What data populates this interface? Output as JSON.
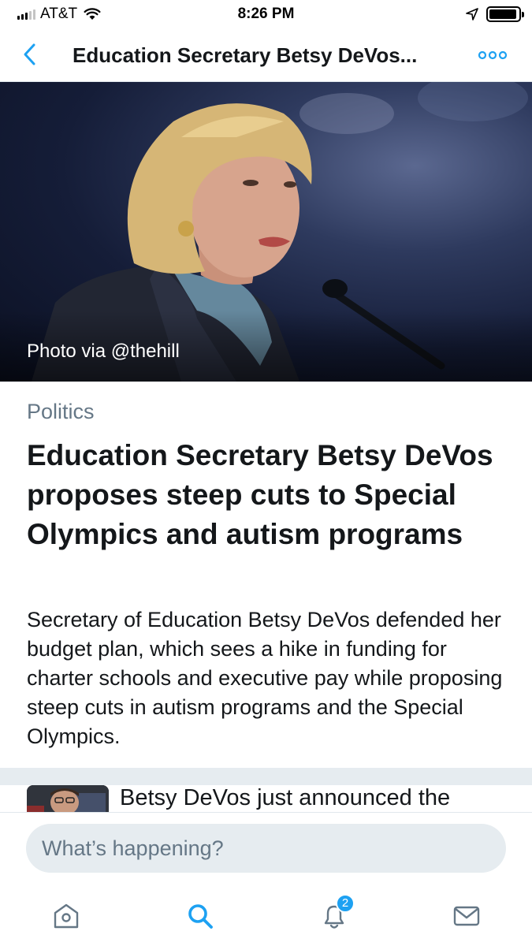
{
  "status_bar": {
    "carrier": "AT&T",
    "time": "8:26 PM",
    "signal_bars_on": 3,
    "signal_bars_total": 5,
    "battery_level": 0.95
  },
  "nav": {
    "title": "Education Secretary Betsy DeVos...",
    "back_icon": "chevron-left-icon",
    "more_icon": "more-dots-icon"
  },
  "article": {
    "photo_credit": "Photo via @thehill",
    "category": "Politics",
    "headline": "Education Secretary Betsy DeVos proposes steep cuts to Special Olympics and autism programs",
    "summary": "Secretary of Education Betsy DeVos defended her budget plan, which sees a hike in funding for charter schools and executive pay while proposing steep cuts in autism programs and the Special Olympics."
  },
  "tweet_preview": {
    "text": "Betsy DeVos just announced the"
  },
  "compose": {
    "placeholder": "What’s happening?"
  },
  "tab_bar": {
    "tabs": [
      {
        "name": "home",
        "icon": "home-icon"
      },
      {
        "name": "search",
        "icon": "search-icon",
        "active": true
      },
      {
        "name": "notifications",
        "icon": "bell-icon",
        "badge": "2"
      },
      {
        "name": "messages",
        "icon": "mail-icon"
      }
    ]
  },
  "colors": {
    "accent": "#1da1f2",
    "text_primary": "#14171a",
    "text_secondary": "#657786",
    "divider": "#e6ecf0",
    "inactive_icon": "#657786"
  }
}
